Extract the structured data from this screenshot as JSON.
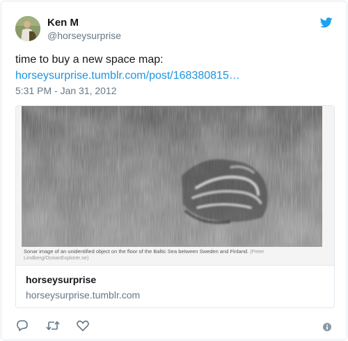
{
  "author": {
    "name": "Ken M",
    "handle": "@horseysurprise"
  },
  "tweet": {
    "text": "time to buy a new space map:",
    "link": "horseysurprise.tumblr.com/post/168380815…",
    "timestamp": "5:31 PM - Jan 31, 2012"
  },
  "card": {
    "image_caption": "Sonar image of an unidentified object on the floor of the Baltic Sea between Sweden and Finland.",
    "image_credit": "(Peter Lindberg/OceanExplorer.se)",
    "title": "horseysurprise",
    "url": "horseysurprise.tumblr.com"
  },
  "icons": {
    "logo": "twitter-bird-icon",
    "reply": "reply-icon",
    "retweet": "retweet-icon",
    "like": "heart-icon",
    "info": "info-icon"
  },
  "colors": {
    "link": "#1b95e0",
    "brand": "#1da1f2",
    "secondary_text": "#657786",
    "border": "#e1e8ed"
  }
}
